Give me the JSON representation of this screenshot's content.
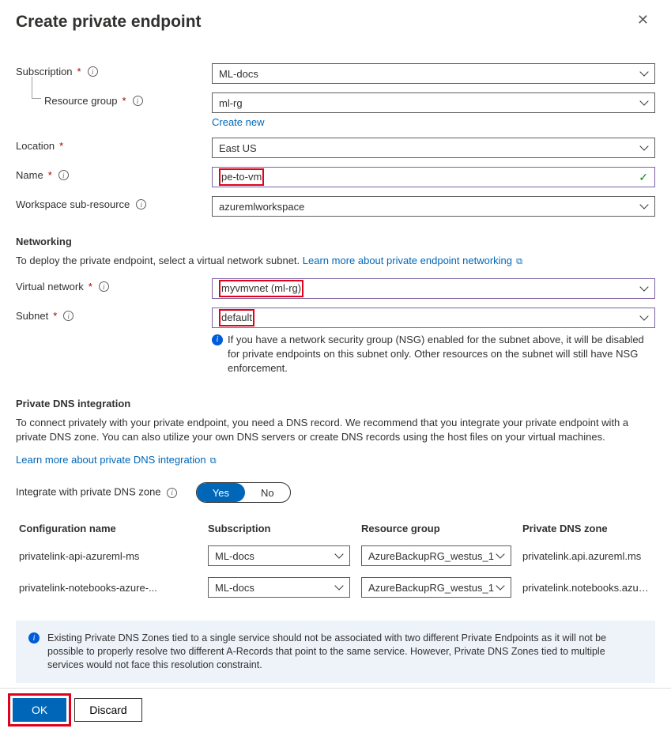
{
  "header": {
    "title": "Create private endpoint"
  },
  "fields": {
    "subscription": {
      "label": "Subscription",
      "value": "ML-docs"
    },
    "resourceGroup": {
      "label": "Resource group",
      "value": "ml-rg",
      "createLink": "Create new"
    },
    "location": {
      "label": "Location",
      "value": "East US"
    },
    "name": {
      "label": "Name",
      "value": "pe-to-vm"
    },
    "subResource": {
      "label": "Workspace sub-resource",
      "value": "azuremlworkspace"
    }
  },
  "networking": {
    "title": "Networking",
    "intro": "To deploy the private endpoint, select a virtual network subnet. ",
    "learnLink": "Learn more about private endpoint networking",
    "vnet": {
      "label": "Virtual network",
      "value": "myvmvnet (ml-rg)"
    },
    "subnet": {
      "label": "Subnet",
      "value": "default",
      "hint": "If you have a network security group (NSG) enabled for the subnet above, it will be disabled for private endpoints on this subnet only. Other resources on the subnet will still have NSG enforcement."
    }
  },
  "dns": {
    "title": "Private DNS integration",
    "intro": "To connect privately with your private endpoint, you need a DNS record. We recommend that you integrate your private endpoint with a private DNS zone. You can also utilize your own DNS servers or create DNS records using the host files on your virtual machines.",
    "learnLink": "Learn more about private DNS integration",
    "toggleLabel": "Integrate with private DNS zone",
    "toggleYes": "Yes",
    "toggleNo": "No",
    "columns": {
      "config": "Configuration name",
      "sub": "Subscription",
      "rg": "Resource group",
      "zone": "Private DNS zone"
    },
    "rows": [
      {
        "config": "privatelink-api-azureml-ms",
        "sub": "ML-docs",
        "rg": "AzureBackupRG_westus_1",
        "zone": "privatelink.api.azureml.ms"
      },
      {
        "config": "privatelink-notebooks-azure-...",
        "sub": "ML-docs",
        "rg": "AzureBackupRG_westus_1",
        "zone": "privatelink.notebooks.azure.n..."
      }
    ],
    "alert": "Existing Private DNS Zones tied to a single service should not be associated with two different Private Endpoints as it will not be possible to properly resolve two different A-Records that point to the same service. However, Private DNS Zones tied to multiple services would not face this resolution constraint."
  },
  "footer": {
    "ok": "OK",
    "discard": "Discard"
  }
}
